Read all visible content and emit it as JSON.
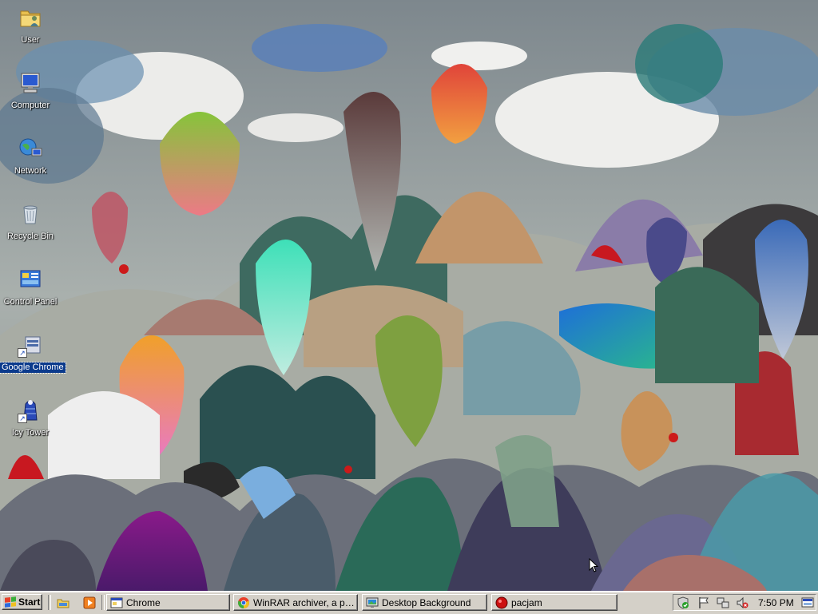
{
  "desktop": {
    "icons": [
      {
        "label": "User",
        "icon": "user-folder-icon"
      },
      {
        "label": "Computer",
        "icon": "computer-icon"
      },
      {
        "label": "Network",
        "icon": "network-icon"
      },
      {
        "label": "Recycle Bin",
        "icon": "recycle-bin-icon"
      },
      {
        "label": "Control Panel",
        "icon": "control-panel-icon"
      },
      {
        "label": "Google Chrome",
        "icon": "chrome-shortcut-icon",
        "selected": true
      },
      {
        "label": "Icy Tower",
        "icon": "icy-tower-shortcut-icon"
      }
    ]
  },
  "taskbar": {
    "start_label": "Start",
    "quick_launch": [
      "show-desktop-icon",
      "media-player-icon"
    ],
    "tasks": [
      {
        "label": "Chrome",
        "icon": "folder-window-icon"
      },
      {
        "label": "WinRAR archiver, a pow...",
        "icon": "chrome-icon"
      },
      {
        "label": "Desktop Background",
        "icon": "display-properties-icon"
      },
      {
        "label": "pacjam",
        "icon": "pacjam-icon"
      }
    ],
    "tray": {
      "icons": [
        "security-shield-icon",
        "flag-icon",
        "network-tray-icon",
        "volume-muted-icon"
      ],
      "time": "7:50 PM",
      "end_icon": "show-desktop-tray-icon"
    }
  },
  "colors": {
    "taskbar": "#d4d0c8",
    "selection": "#0b3a8c"
  }
}
